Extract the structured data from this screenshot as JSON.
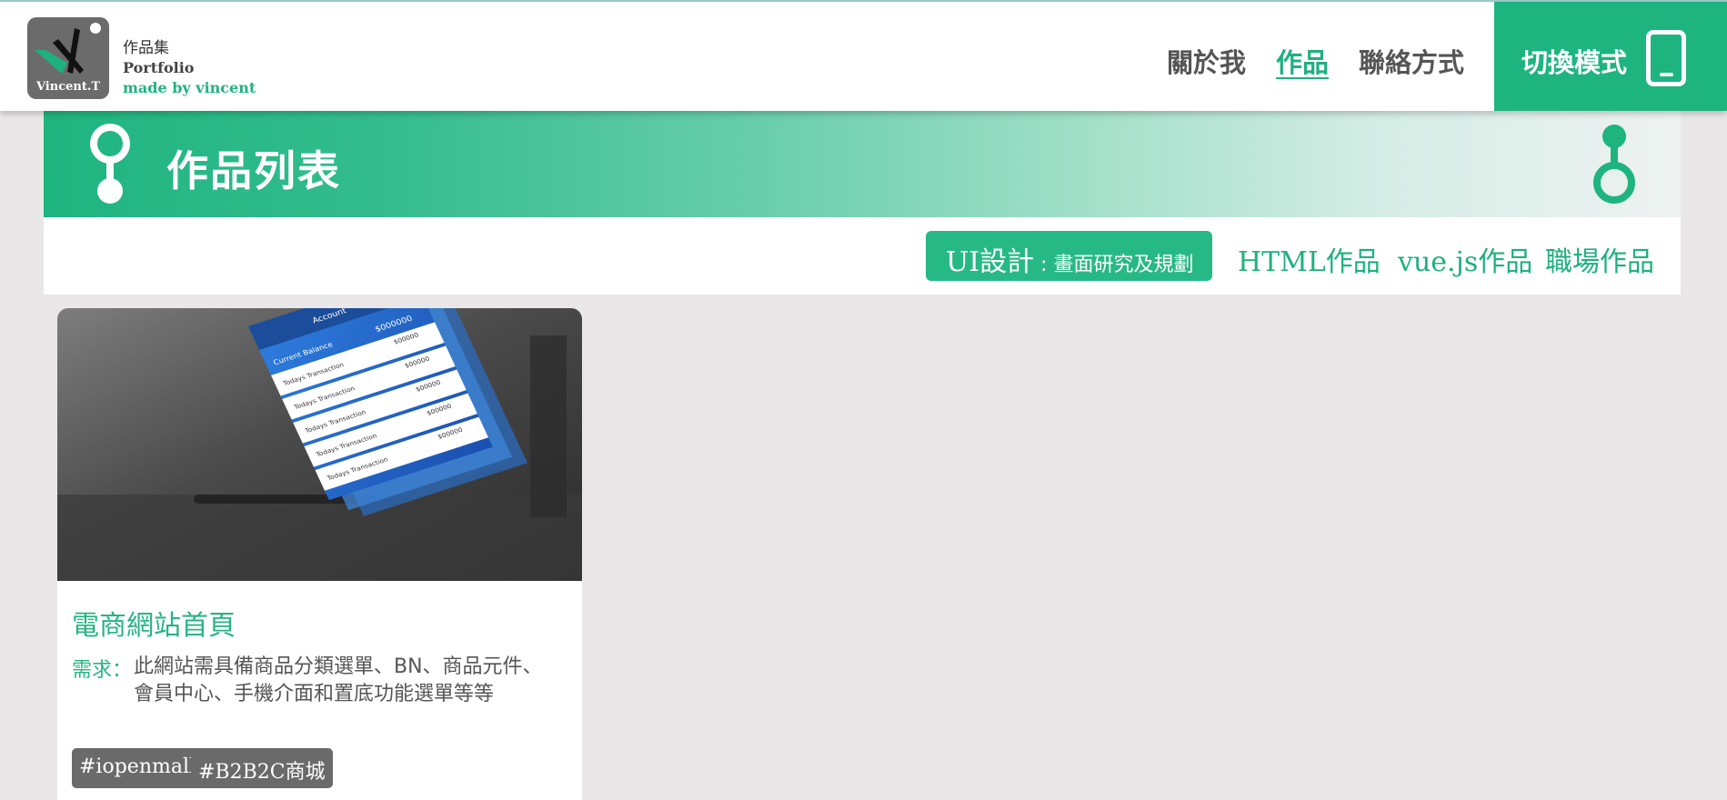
{
  "header": {
    "logo_text": "Vincent.T",
    "brand_cn": "作品集",
    "brand_en": "Portfolio",
    "brand_sub": "made by vincent",
    "nav": [
      {
        "label": "關於我",
        "active": false
      },
      {
        "label": "作品",
        "active": true
      },
      {
        "label": "聯絡方式",
        "active": false
      }
    ],
    "switch_label": "切換模式",
    "switch_icon": "mobile-phone-icon"
  },
  "banner": {
    "title": "作品列表",
    "icons": [
      "pin-icon",
      "pin-icon"
    ]
  },
  "filters": {
    "active_main": "UI設計",
    "active_sub": " : 畫面研究及規劃",
    "items": [
      "HTML作品",
      "vue.js作品",
      "職場作品"
    ]
  },
  "card": {
    "title": "電商網站首頁",
    "requirement_label": "需求：",
    "requirement_text": "此網站需具備商品分類選單、BN、商品元件、會員中心、手機介面和置底功能選單等等",
    "tags": [
      "#iopenmall",
      "#B2B2C商城"
    ],
    "mockup_text": {
      "header": "Account",
      "balance": "Current Balance",
      "amount": "$000000",
      "row_title": "Todays Transaction",
      "row_amount": "$00000"
    }
  },
  "colors": {
    "accent": "#1eb480",
    "tag_bg": "#6a6a6a",
    "page_bg": "#e9e7e7"
  }
}
